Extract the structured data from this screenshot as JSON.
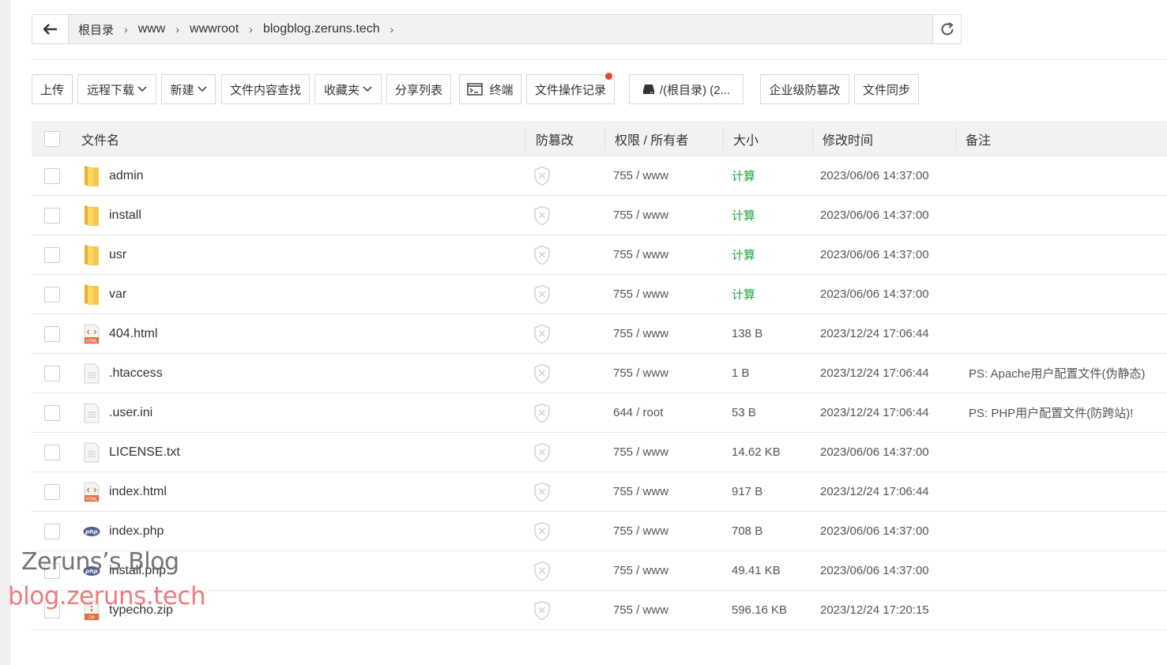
{
  "breadcrumb": {
    "back_icon": "arrow-left-icon",
    "items": [
      "根目录",
      "www",
      "wwwroot",
      "blogblog.zeruns.tech"
    ],
    "refresh_icon": "refresh-icon"
  },
  "toolbar": {
    "upload": "上传",
    "remote_download": "远程下载",
    "new": "新建",
    "search_content": "文件内容查找",
    "favorites": "收藏夹",
    "share_list": "分享列表",
    "terminal": "终端",
    "operation_log": "文件操作记录",
    "disk": "/(根目录) (2...",
    "tamper_proof": "企业级防篡改",
    "file_sync": "文件同步"
  },
  "table": {
    "headers": {
      "name": "文件名",
      "tamper": "防篡改",
      "perm": "权限 / 所有者",
      "size": "大小",
      "mtime": "修改时间",
      "note": "备注"
    },
    "rows": [
      {
        "name": "admin",
        "icon": "folder-icon",
        "perm": "755 / www",
        "size": "计算",
        "mtime": "2023/06/06 14:37:00",
        "note": ""
      },
      {
        "name": "install",
        "icon": "folder-icon",
        "perm": "755 / www",
        "size": "计算",
        "mtime": "2023/06/06 14:37:00",
        "note": ""
      },
      {
        "name": "usr",
        "icon": "folder-icon",
        "perm": "755 / www",
        "size": "计算",
        "mtime": "2023/06/06 14:37:00",
        "note": ""
      },
      {
        "name": "var",
        "icon": "folder-icon",
        "perm": "755 / www",
        "size": "计算",
        "mtime": "2023/06/06 14:37:00",
        "note": ""
      },
      {
        "name": "404.html",
        "icon": "html-file-icon",
        "perm": "755 / www",
        "size": "138 B",
        "mtime": "2023/12/24 17:06:44",
        "note": ""
      },
      {
        "name": ".htaccess",
        "icon": "text-file-icon",
        "perm": "755 / www",
        "size": "1 B",
        "mtime": "2023/12/24 17:06:44",
        "note": "PS: Apache用户配置文件(伪静态)"
      },
      {
        "name": ".user.ini",
        "icon": "text-file-icon",
        "perm": "644 / root",
        "size": "53 B",
        "mtime": "2023/12/24 17:06:44",
        "note": "PS: PHP用户配置文件(防跨站)!"
      },
      {
        "name": "LICENSE.txt",
        "icon": "text-file-icon",
        "perm": "755 / www",
        "size": "14.62 KB",
        "mtime": "2023/06/06 14:37:00",
        "note": ""
      },
      {
        "name": "index.html",
        "icon": "html-file-icon",
        "perm": "755 / www",
        "size": "917 B",
        "mtime": "2023/12/24 17:06:44",
        "note": ""
      },
      {
        "name": "index.php",
        "icon": "php-file-icon",
        "perm": "755 / www",
        "size": "708 B",
        "mtime": "2023/06/06 14:37:00",
        "note": ""
      },
      {
        "name": "install.php",
        "icon": "php-file-icon",
        "perm": "755 / www",
        "size": "49.41 KB",
        "mtime": "2023/06/06 14:37:00",
        "note": ""
      },
      {
        "name": "typecho.zip",
        "icon": "zip-file-icon",
        "perm": "755 / www",
        "size": "596.16 KB",
        "mtime": "2023/12/24 17:20:15",
        "note": ""
      }
    ]
  },
  "watermark": {
    "line1": "Zeruns’s Blog",
    "line2": "blog.zeruns.tech"
  },
  "colors": {
    "calc_green": "#20a53a",
    "notify_red": "#f0443a",
    "folder_yellow": "#f8c84a"
  }
}
